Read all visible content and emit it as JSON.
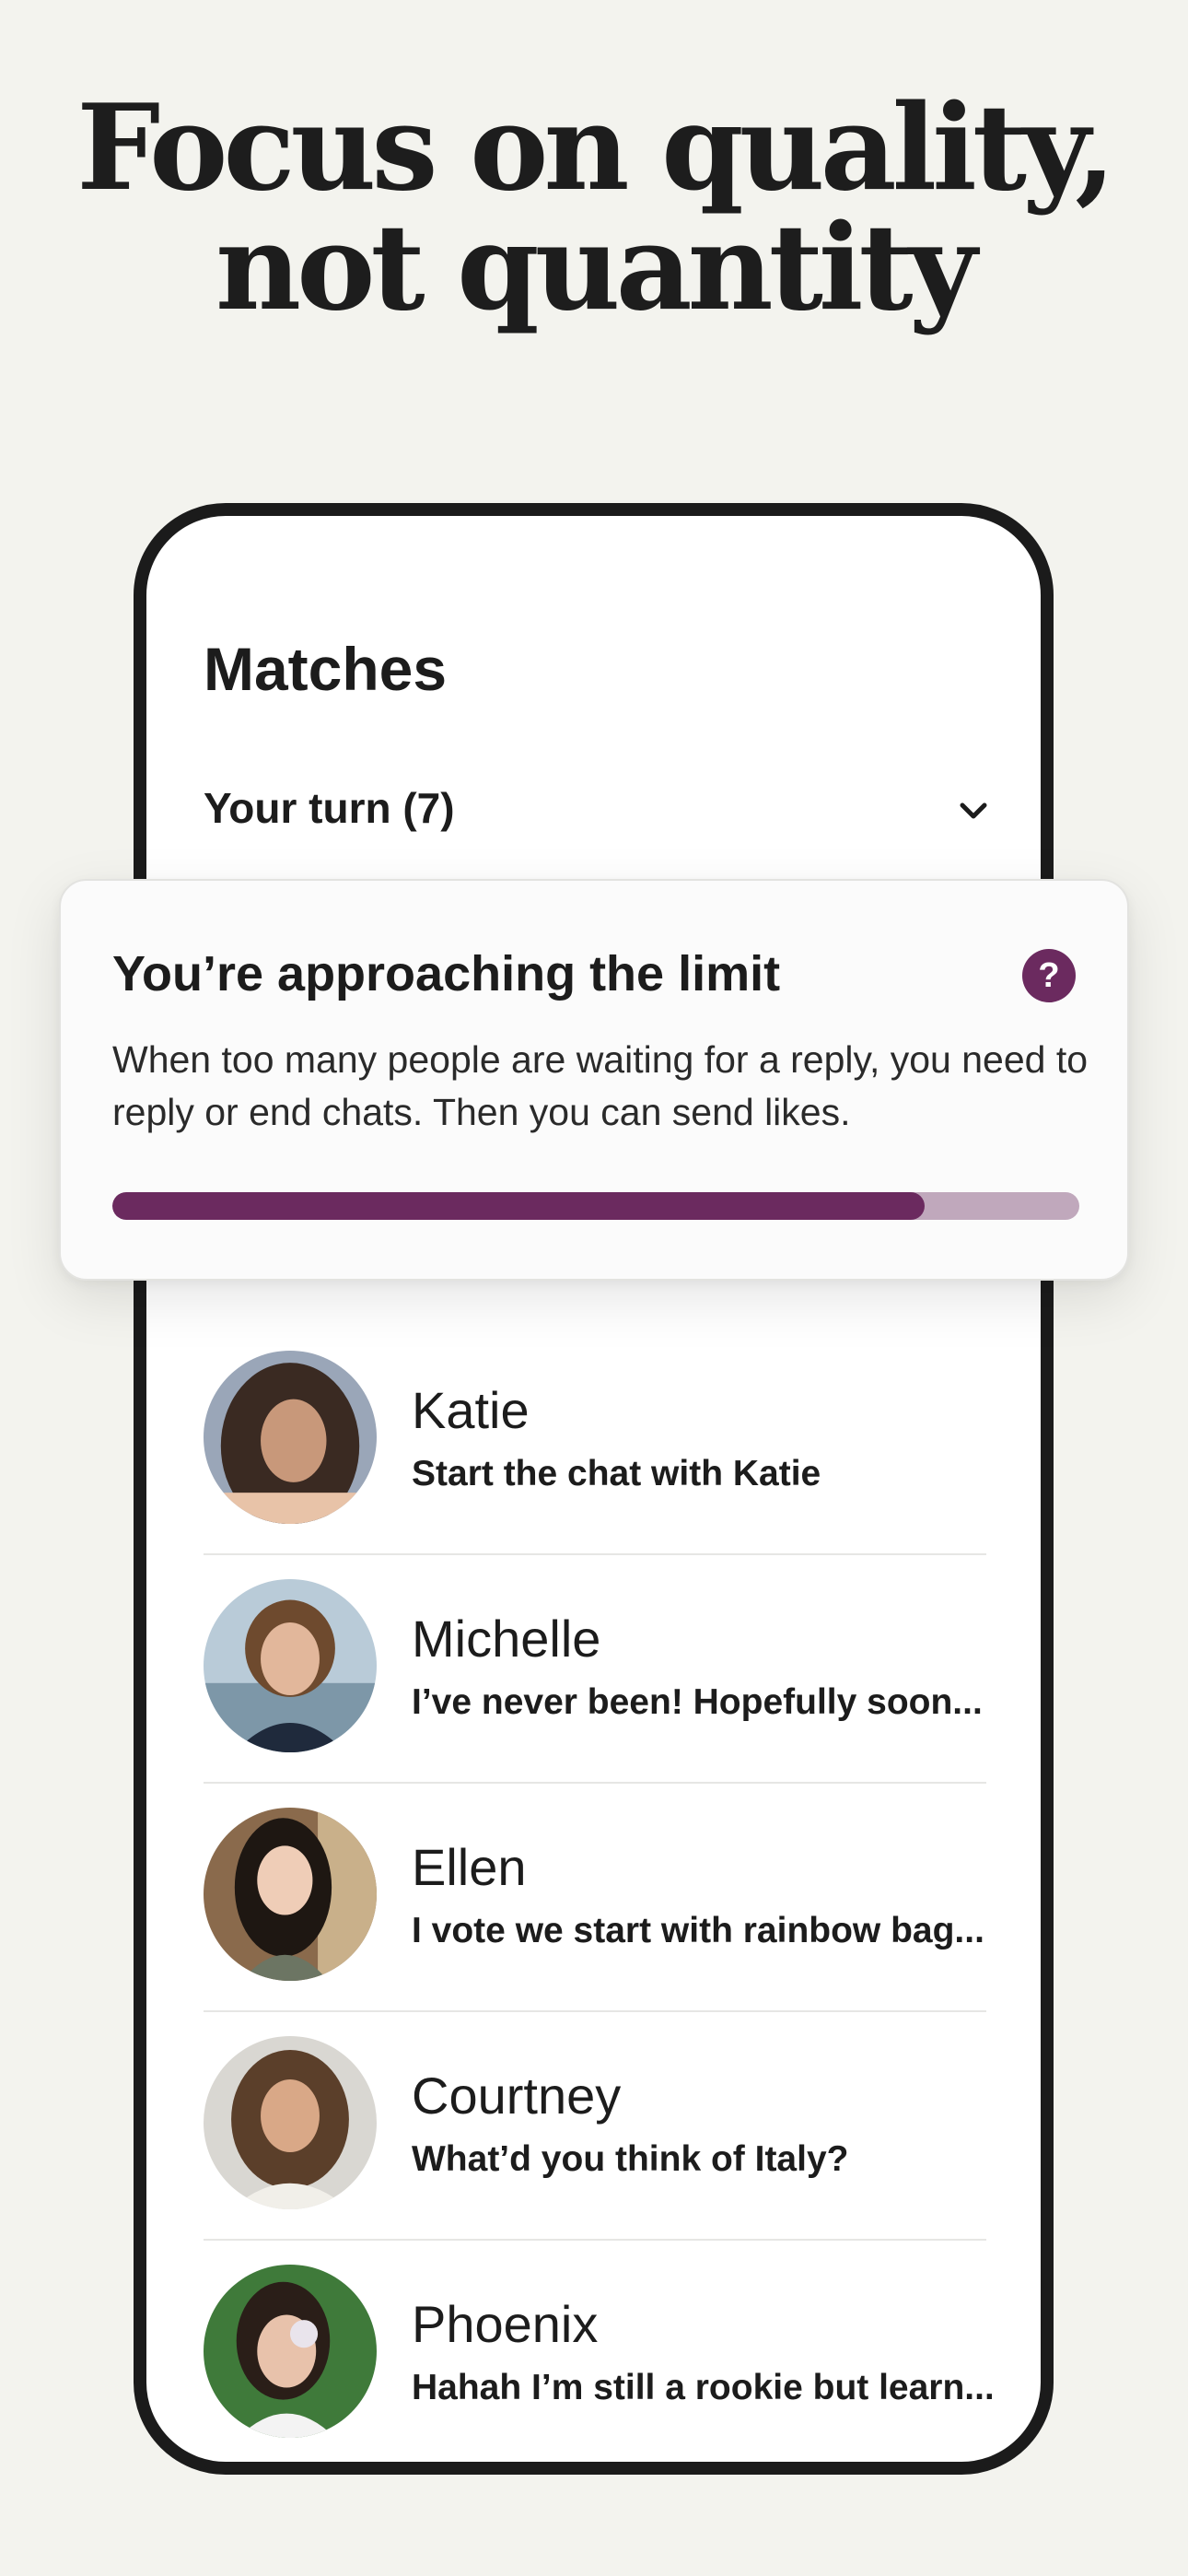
{
  "headline": {
    "line1": "Focus on quality,",
    "line2": "not quantity"
  },
  "screen": {
    "title": "Matches",
    "your_turn_label": "Your turn (7)",
    "chevron_icon": "chevron-down-icon"
  },
  "limit_card": {
    "title": "You’re approaching the limit",
    "help_icon": "question-icon",
    "help_glyph": "?",
    "body": "When too many people are waiting for a reply, you need to reply or end chats. Then you can send likes.",
    "progress": 0.84,
    "colors": {
      "fill": "#6b2a5f",
      "track": "#c0a8bc"
    }
  },
  "matches": [
    {
      "name": "Katie",
      "message": "Start the chat with Katie"
    },
    {
      "name": "Michelle",
      "message": "I’ve never been! Hopefully soon..."
    },
    {
      "name": "Ellen",
      "message": "I vote we start with rainbow bag..."
    },
    {
      "name": "Courtney",
      "message": "What’d you think of Italy?"
    },
    {
      "name": "Phoenix",
      "message": "Hahah I’m still a rookie but learn..."
    }
  ]
}
